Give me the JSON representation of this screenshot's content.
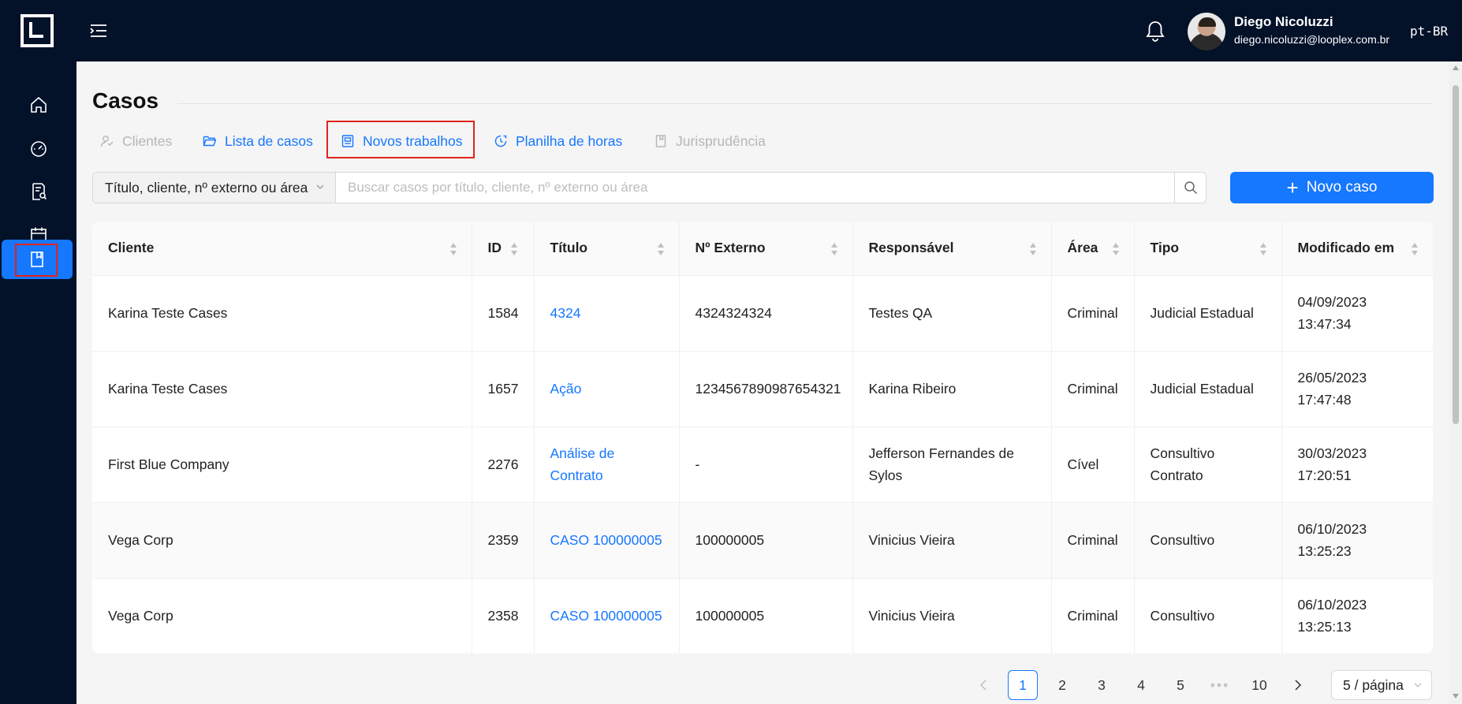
{
  "header": {
    "user_name": "Diego Nicoluzzi",
    "user_email": "diego.nicoluzzi@looplex.com.br",
    "language": "pt-BR"
  },
  "sidebar": {
    "items": [
      {
        "icon": "home-icon"
      },
      {
        "icon": "dashboard-icon"
      },
      {
        "icon": "document-search-icon"
      },
      {
        "icon": "calendar-icon"
      },
      {
        "icon": "book-icon",
        "active": true
      }
    ]
  },
  "page": {
    "title": "Casos"
  },
  "tabs": [
    {
      "label": "Clientes",
      "icon": "clients-icon",
      "disabled": true
    },
    {
      "label": "Lista de casos",
      "icon": "folder-open-icon"
    },
    {
      "label": "Novos trabalhos",
      "icon": "new-work-icon"
    },
    {
      "label": "Planilha de horas",
      "icon": "timesheet-icon"
    },
    {
      "label": "Jurisprudência",
      "icon": "jurisprudence-icon",
      "disabled": true
    }
  ],
  "search": {
    "filter_selected": "Título, cliente, nº externo ou área",
    "placeholder": "Buscar casos por título, cliente, nº externo ou área"
  },
  "new_case_button": "Novo caso",
  "table": {
    "columns": [
      "Cliente",
      "ID",
      "Título",
      "Nº Externo",
      "Responsável",
      "Área",
      "Tipo",
      "Modificado em"
    ],
    "rows": [
      {
        "cliente": "Karina Teste Cases",
        "id": "1584",
        "titulo": "4324",
        "externo": "4324324324",
        "responsavel": "Testes QA",
        "area": "Criminal",
        "tipo": "Judicial Estadual",
        "data": "04/09/2023",
        "hora": "13:47:34"
      },
      {
        "cliente": "Karina Teste Cases",
        "id": "1657",
        "titulo": "Ação",
        "externo": "1234567890987654321",
        "responsavel": "Karina Ribeiro",
        "area": "Criminal",
        "tipo": "Judicial Estadual",
        "data": "26/05/2023",
        "hora": "17:47:48"
      },
      {
        "cliente": "First Blue Company",
        "id": "2276",
        "titulo": "Análise de Contrato",
        "externo": "-",
        "responsavel": "Jefferson Fernandes de Sylos",
        "area": "Cível",
        "tipo": "Consultivo Contrato",
        "data": "30/03/2023",
        "hora": "17:20:51"
      },
      {
        "cliente": "Vega Corp",
        "id": "2359",
        "titulo": "CASO 100000005",
        "externo": "100000005",
        "responsavel": "Vinicius Vieira",
        "area": "Criminal",
        "tipo": "Consultivo",
        "data": "06/10/2023",
        "hora": "13:25:23"
      },
      {
        "cliente": "Vega Corp",
        "id": "2358",
        "titulo": "CASO 100000005",
        "externo": "100000005",
        "responsavel": "Vinicius Vieira",
        "area": "Criminal",
        "tipo": "Consultivo",
        "data": "06/10/2023",
        "hora": "13:25:13"
      }
    ]
  },
  "pagination": {
    "pages": [
      "1",
      "2",
      "3",
      "4",
      "5"
    ],
    "ellipsis": "•••",
    "last_page": "10",
    "current": "1",
    "page_size": "5 / página"
  },
  "colors": {
    "primary": "#1677ff",
    "dark_bg": "#031129",
    "highlight": "#e0241a"
  }
}
